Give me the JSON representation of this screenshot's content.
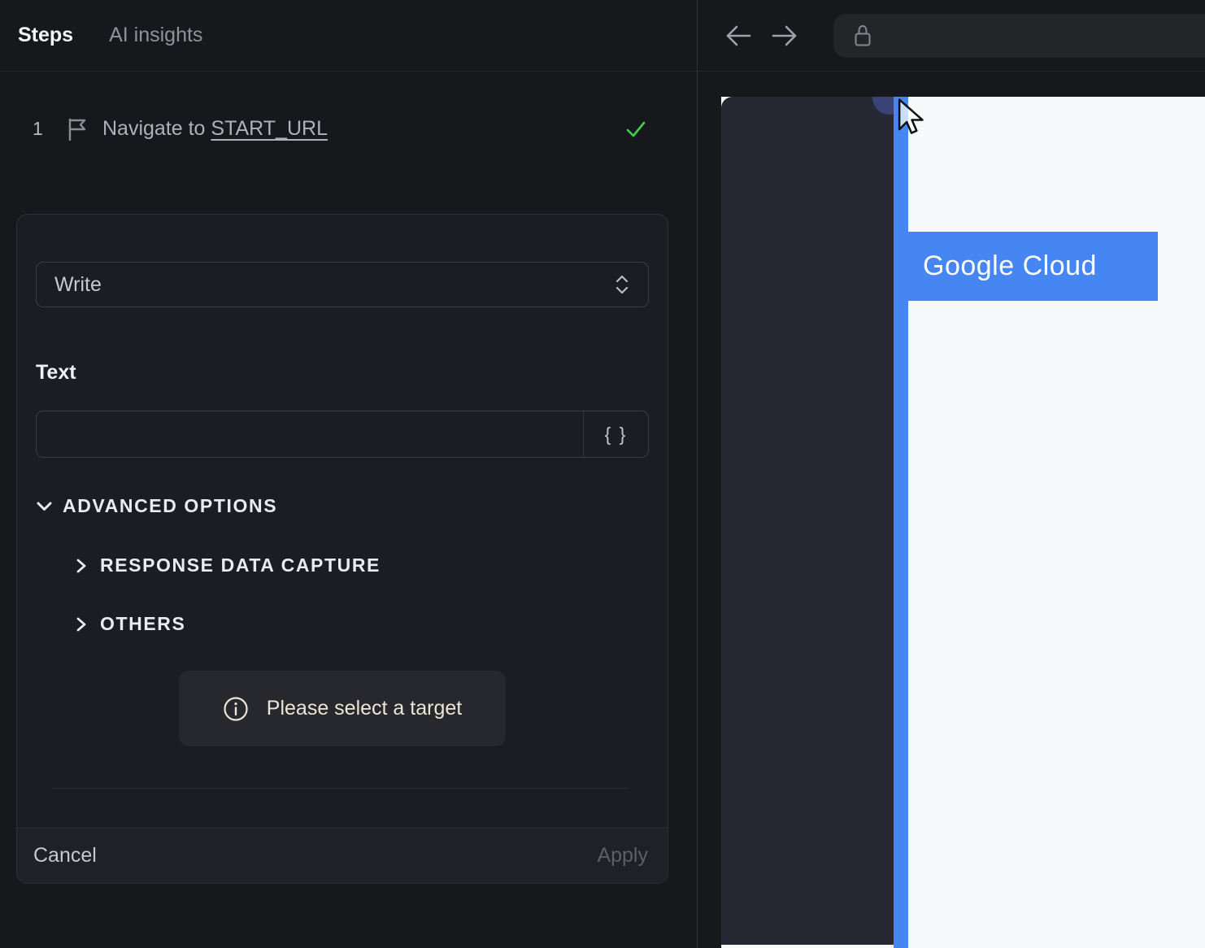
{
  "colors": {
    "accent": "#4686f3",
    "success": "#38d44f",
    "page_white": "#f8f9fa"
  },
  "left_panel": {
    "tabs": [
      {
        "label": "Steps"
      },
      {
        "label": "AI insights"
      }
    ],
    "step": {
      "number": "1",
      "prefix": "Navigate to ",
      "target": "START_URL"
    },
    "editor": {
      "action_select": {
        "value": "Write"
      },
      "text_field": {
        "label": "Text",
        "value": ""
      },
      "braces_button": "{ }",
      "advanced_header": "ADVANCED OPTIONS",
      "sections": [
        {
          "label": "RESPONSE DATA CAPTURE"
        },
        {
          "label": "OTHERS"
        }
      ],
      "notice": "Please select a target",
      "footer": {
        "cancel": "Cancel",
        "apply": "Apply"
      }
    }
  },
  "right_panel": {
    "browser": {
      "url": ""
    },
    "page": {
      "banner": "Google Cloud"
    }
  }
}
